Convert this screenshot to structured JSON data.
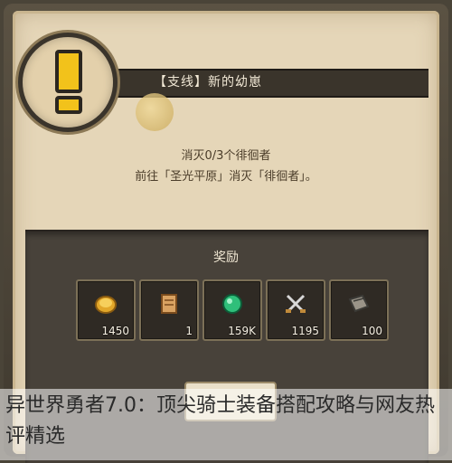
{
  "quest": {
    "title": "【支线】新的幼崽",
    "objective_progress": "消灭0/3个徘徊者",
    "objective_detail": "前往「圣光平原」消灭「徘徊者」。"
  },
  "rewards": {
    "title": "奖励",
    "items": [
      {
        "icon": "gold-coin-icon",
        "qty": "1450"
      },
      {
        "icon": "scroll-icon",
        "qty": "1"
      },
      {
        "icon": "green-gem-icon",
        "qty": "159K"
      },
      {
        "icon": "crossed-swords-icon",
        "qty": "1195"
      },
      {
        "icon": "book-icon",
        "qty": "100"
      }
    ]
  },
  "caption": {
    "text": "异世界勇者7.0：顶尖骑士装备搭配攻略与网友热评精选"
  },
  "colors": {
    "parchment": "#e5d6b8",
    "banner": "#3a342b",
    "alert_yellow": "#f2c21b"
  }
}
